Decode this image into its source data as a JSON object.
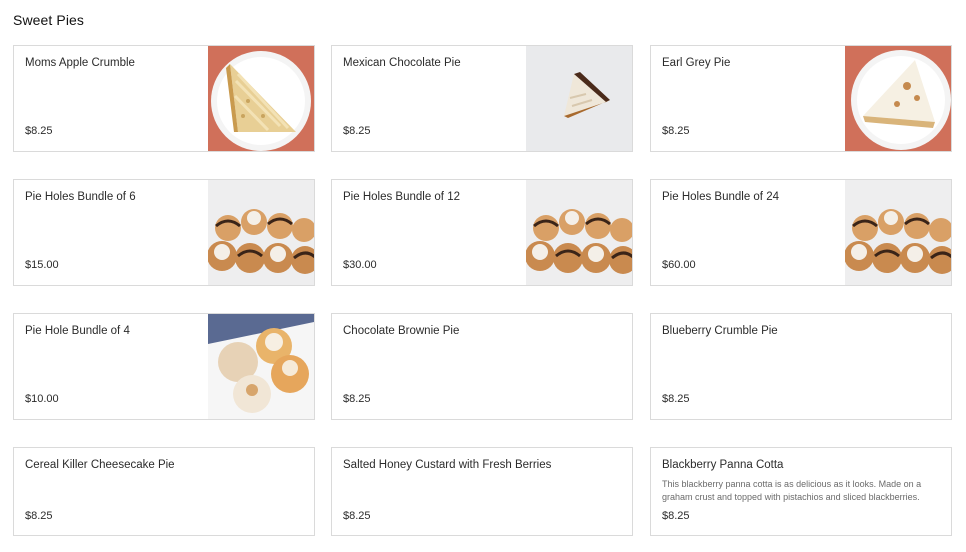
{
  "section": {
    "title": "Sweet Pies"
  },
  "items": [
    {
      "name": "Moms Apple Crumble",
      "price": "$8.25",
      "image": "apple-crumble-slice"
    },
    {
      "name": "Mexican Chocolate Pie",
      "price": "$8.25",
      "image": "chocolate-pie-slice"
    },
    {
      "name": "Earl Grey Pie",
      "price": "$8.25",
      "image": "earl-grey-slice"
    },
    {
      "name": "Pie Holes Bundle of 6",
      "price": "$15.00",
      "image": "pie-holes-bundle"
    },
    {
      "name": "Pie Holes Bundle of 12",
      "price": "$30.00",
      "image": "pie-holes-bundle"
    },
    {
      "name": "Pie Holes Bundle of 24",
      "price": "$60.00",
      "image": "pie-holes-bundle"
    },
    {
      "name": "Pie Hole Bundle of 4",
      "price": "$10.00",
      "image": "pie-holes-plate"
    },
    {
      "name": "Chocolate Brownie Pie",
      "price": "$8.25"
    },
    {
      "name": "Blueberry Crumble Pie",
      "price": "$8.25"
    },
    {
      "name": "Cereal Killer Cheesecake Pie",
      "price": "$8.25"
    },
    {
      "name": "Salted Honey Custard with Fresh Berries",
      "price": "$8.25"
    },
    {
      "name": "Blackberry Panna Cotta",
      "price": "$8.25",
      "description": "This blackberry panna cotta is as delicious as it looks. Made on a graham crust and topped with pistachios and sliced blackberries."
    }
  ],
  "colors": {
    "border": "#dadada",
    "terracotta": "#d0705a",
    "text": "#2b2b2b"
  }
}
